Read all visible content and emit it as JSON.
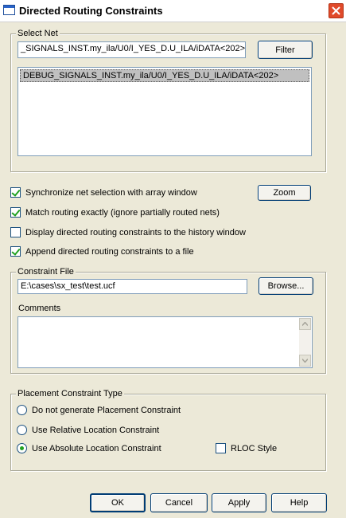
{
  "window": {
    "title": "Directed Routing Constraints"
  },
  "select_net": {
    "legend": "Select Net",
    "search_value": "_SIGNALS_INST.my_ila/U0/I_YES_D.U_ILA/iDATA<202>",
    "filter_label": "Filter",
    "list_items": [
      "DEBUG_SIGNALS_INST.my_ila/U0/I_YES_D.U_ILA/iDATA<202>"
    ]
  },
  "options": [
    {
      "label": "Synchronize net selection with array window",
      "checked": true
    },
    {
      "label": "Match routing exactly (ignore partially routed nets)",
      "checked": true
    },
    {
      "label": "Display directed routing constraints to the history window",
      "checked": false
    },
    {
      "label": "Append directed routing constraints to a file",
      "checked": true
    }
  ],
  "zoom_label": "Zoom",
  "constraint_file": {
    "legend": "Constraint File",
    "path": "E:\\cases\\sx_test\\test.ucf",
    "browse_label": "Browse...",
    "comments_label": "Comments",
    "comments_value": ""
  },
  "placement": {
    "legend": "Placement Constraint Type",
    "options": [
      {
        "label": "Do not generate Placement Constraint",
        "selected": false
      },
      {
        "label": "Use Relative Location Constraint",
        "selected": false
      },
      {
        "label": "Use Absolute Location Constraint",
        "selected": true
      }
    ],
    "rloc_label": "RLOC Style",
    "rloc_checked": false
  },
  "footer": {
    "ok_label": "OK",
    "cancel_label": "Cancel",
    "apply_label": "Apply",
    "help_label": "Help"
  }
}
